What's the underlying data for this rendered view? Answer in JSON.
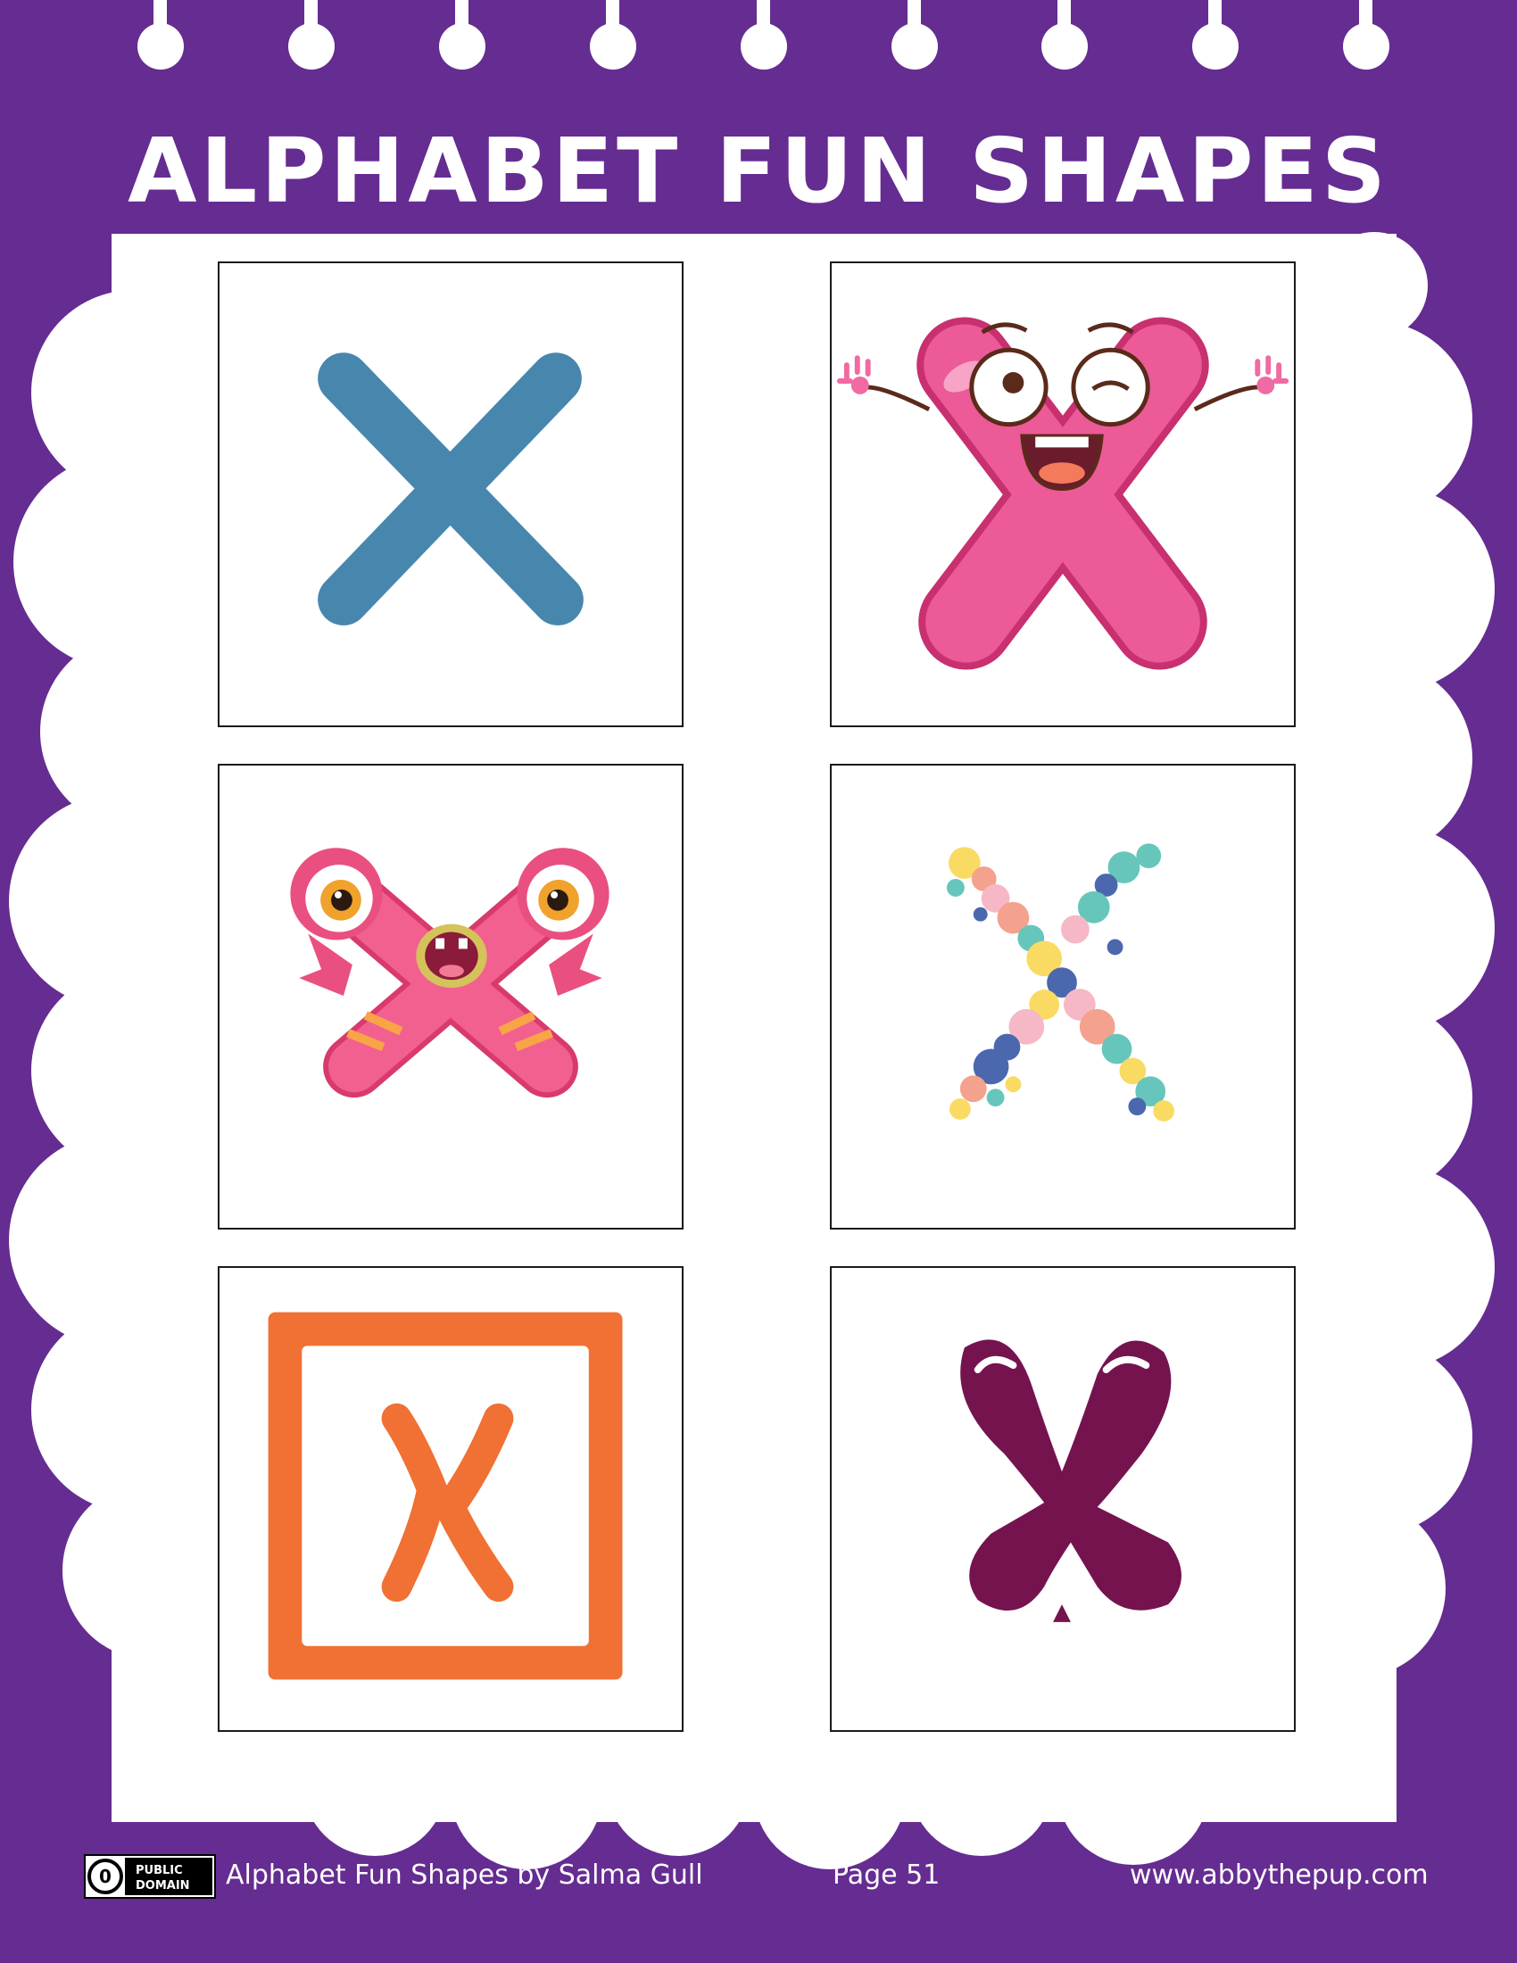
{
  "header": {
    "title": "ALPHABET FUN SHAPES"
  },
  "cards": [
    {
      "letter": "X",
      "style": "plain-blue"
    },
    {
      "letter": "X",
      "style": "smiling-pink-character"
    },
    {
      "letter": "X",
      "style": "pink-monster"
    },
    {
      "letter": "X",
      "style": "colorful-bubbles"
    },
    {
      "letter": "X",
      "style": "orange-framed"
    },
    {
      "letter": "X",
      "style": "purple-balloon"
    }
  ],
  "footer": {
    "license_badge": {
      "line1": "PUBLIC",
      "line2": "DOMAIN",
      "symbol": "0"
    },
    "credit": "Alphabet Fun Shapes by Salma Gull",
    "page": "Page 51",
    "website": "www.abbythepup.com"
  },
  "colors": {
    "background": "#652c91",
    "blue_x": "#4787ae",
    "pink": "#e94b8d",
    "orange": "#f07133",
    "plum": "#75134f"
  }
}
